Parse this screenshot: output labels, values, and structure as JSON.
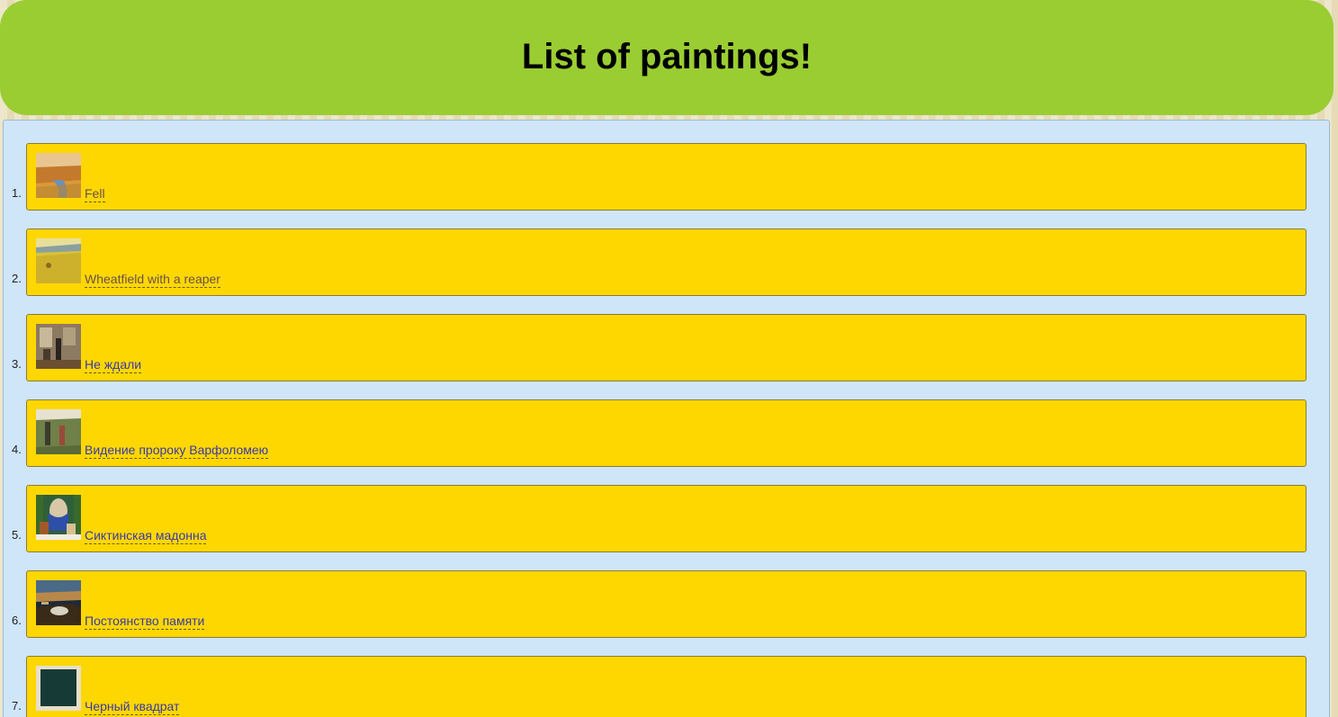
{
  "header": {
    "title": "List of paintings!"
  },
  "paintings": [
    {
      "number": "1.",
      "title": "Fell",
      "thumb": "autumn-landscape-thumbnail"
    },
    {
      "number": "2.",
      "title": "Wheatfield with a reaper",
      "thumb": "wheatfield-thumbnail"
    },
    {
      "number": "3.",
      "title": "Не ждали",
      "thumb": "interior-scene-thumbnail"
    },
    {
      "number": "4.",
      "title": "Видение пророку Варфоломею",
      "thumb": "meadow-figures-thumbnail"
    },
    {
      "number": "5.",
      "title": "Сиктинская мадонна",
      "thumb": "madonna-thumbnail"
    },
    {
      "number": "6.",
      "title": "Постоянство памяти",
      "thumb": "melting-clocks-thumbnail"
    },
    {
      "number": "7.",
      "title": "Черный квадрат",
      "thumb": "black-square-thumbnail"
    }
  ],
  "colors": {
    "header_bg": "#9acd32",
    "content_bg": "#cfe5f8",
    "card_bg": "#ffd700",
    "link": "#3a3aa8"
  }
}
